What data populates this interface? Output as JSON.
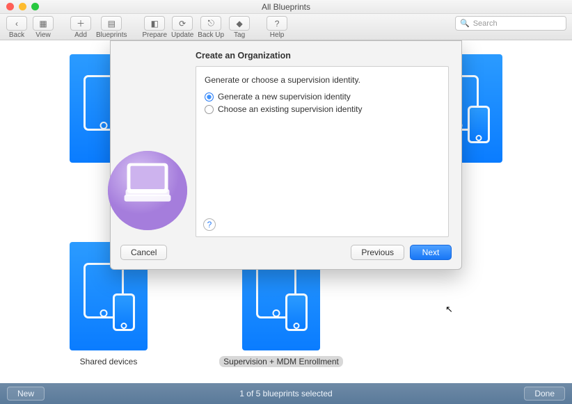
{
  "window": {
    "title": "All Blueprints"
  },
  "toolbar": {
    "back": "Back",
    "view": "View",
    "add": "Add",
    "blueprints": "Blueprints",
    "prepare": "Prepare",
    "update": "Update",
    "backup": "Back Up",
    "tag": "Tag",
    "help": "Help",
    "search_placeholder": "Search"
  },
  "blueprints": {
    "items": [
      {
        "label": ""
      },
      {
        "label": ""
      },
      {
        "label": "Shared devices"
      },
      {
        "label": "Supervision + MDM Enrollment"
      }
    ],
    "selected_index": 3
  },
  "dialog": {
    "title": "Create an Organization",
    "prompt": "Generate or choose a supervision identity.",
    "options": [
      {
        "label": "Generate a new supervision identity",
        "selected": true
      },
      {
        "label": "Choose an existing supervision identity",
        "selected": false
      }
    ],
    "help_glyph": "?",
    "cancel": "Cancel",
    "previous": "Previous",
    "next": "Next"
  },
  "bottom": {
    "new": "New",
    "status": "1 of 5 blueprints selected",
    "done": "Done"
  }
}
